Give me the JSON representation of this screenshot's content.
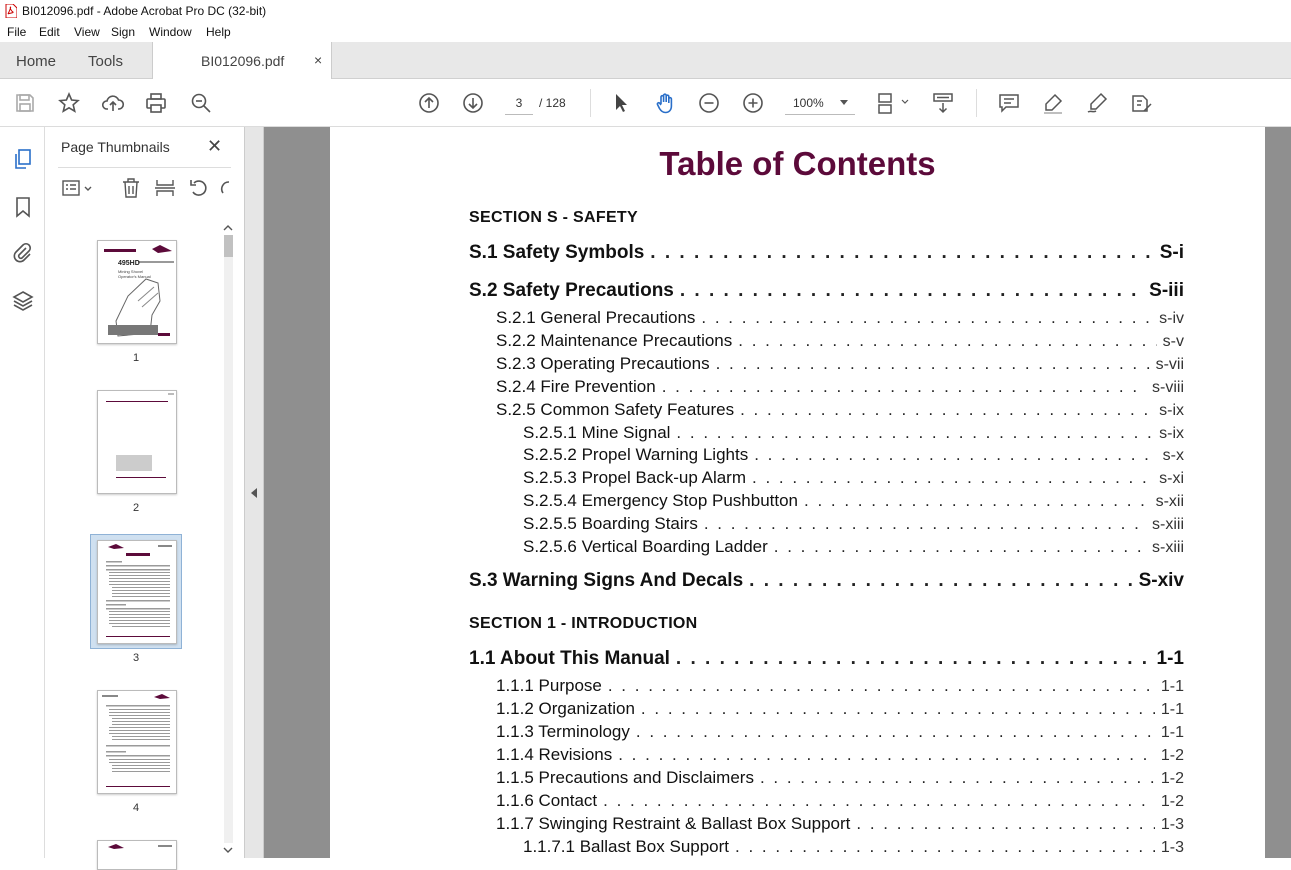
{
  "window": {
    "title": "BI012096.pdf - Adobe Acrobat Pro DC (32-bit)"
  },
  "menu": [
    "File",
    "Edit",
    "View",
    "Sign",
    "Window",
    "Help"
  ],
  "tabs": {
    "home": "Home",
    "tools": "Tools",
    "document": "BI012096.pdf",
    "close": "×"
  },
  "toolbar": {
    "page_current": "3",
    "page_total": "/ 128",
    "zoom": "100%"
  },
  "thumbnails": {
    "title": "Page Thumbnails",
    "close": "✕",
    "pages": [
      "1",
      "2",
      "3",
      "4"
    ],
    "selected": "3",
    "cover_model": "495HD",
    "cover_sub": "Mining Shovel\nOperator's Manual"
  },
  "document": {
    "title": "Table of Contents",
    "sections": [
      {
        "heading": "SECTION S - SAFETY"
      },
      {
        "heading": "SECTION 1 - INTRODUCTION"
      }
    ],
    "entries": [
      {
        "level": 1,
        "text": "S.1 Safety Symbols",
        "page": "S-i"
      },
      {
        "level": 1,
        "text": "S.2 Safety Precautions",
        "page": "S-iii"
      },
      {
        "level": 2,
        "text": "S.2.1 General Precautions",
        "page": "s-iv"
      },
      {
        "level": 2,
        "text": "S.2.2 Maintenance Precautions",
        "page": "s-v"
      },
      {
        "level": 2,
        "text": "S.2.3 Operating Precautions",
        "page": "s-vii"
      },
      {
        "level": 2,
        "text": "S.2.4 Fire Prevention",
        "page": "s-viii"
      },
      {
        "level": 2,
        "text": "S.2.5 Common Safety Features",
        "page": "s-ix"
      },
      {
        "level": 3,
        "text": "S.2.5.1 Mine Signal",
        "page": "s-ix"
      },
      {
        "level": 3,
        "text": "S.2.5.2 Propel Warning Lights",
        "page": "s-x"
      },
      {
        "level": 3,
        "text": "S.2.5.3 Propel Back-up Alarm",
        "page": "s-xi"
      },
      {
        "level": 3,
        "text": "S.2.5.4 Emergency Stop Pushbutton",
        "page": "s-xii"
      },
      {
        "level": 3,
        "text": "S.2.5.5 Boarding Stairs",
        "page": "s-xiii"
      },
      {
        "level": 3,
        "text": "S.2.5.6 Vertical Boarding Ladder",
        "page": "s-xiii"
      },
      {
        "level": 1,
        "text": "S.3 Warning Signs And Decals",
        "page": "S-xiv"
      },
      {
        "level": 1,
        "text": "1.1 About This Manual",
        "page": "1-1"
      },
      {
        "level": 2,
        "text": "1.1.1 Purpose",
        "page": "1-1"
      },
      {
        "level": 2,
        "text": "1.1.2 Organization",
        "page": "1-1"
      },
      {
        "level": 2,
        "text": "1.1.3 Terminology",
        "page": "1-1"
      },
      {
        "level": 2,
        "text": "1.1.4 Revisions",
        "page": "1-2"
      },
      {
        "level": 2,
        "text": "1.1.5 Precautions and Disclaimers",
        "page": "1-2"
      },
      {
        "level": 2,
        "text": "1.1.6 Contact",
        "page": "1-2"
      },
      {
        "level": 2,
        "text": "1.1.7 Swinging Restraint & Ballast Box Support",
        "page": "1-3"
      },
      {
        "level": 3,
        "text": "1.1.7.1 Ballast Box Support",
        "page": "1-3"
      }
    ]
  },
  "colors": {
    "toc_title": "#5c0a3a",
    "accent_blue": "#2a6fc9",
    "selection": "#cfe0f0"
  },
  "icons": [
    "save-icon",
    "star-icon",
    "upload-icon",
    "print-icon",
    "search-zoom-icon",
    "page-up-icon",
    "page-down-icon",
    "select-arrow-icon",
    "hand-icon",
    "zoom-out-icon",
    "zoom-in-icon",
    "page-fit-icon",
    "scroll-mode-icon",
    "comment-icon",
    "highlight-icon",
    "sign-icon",
    "more-tools-icon"
  ]
}
